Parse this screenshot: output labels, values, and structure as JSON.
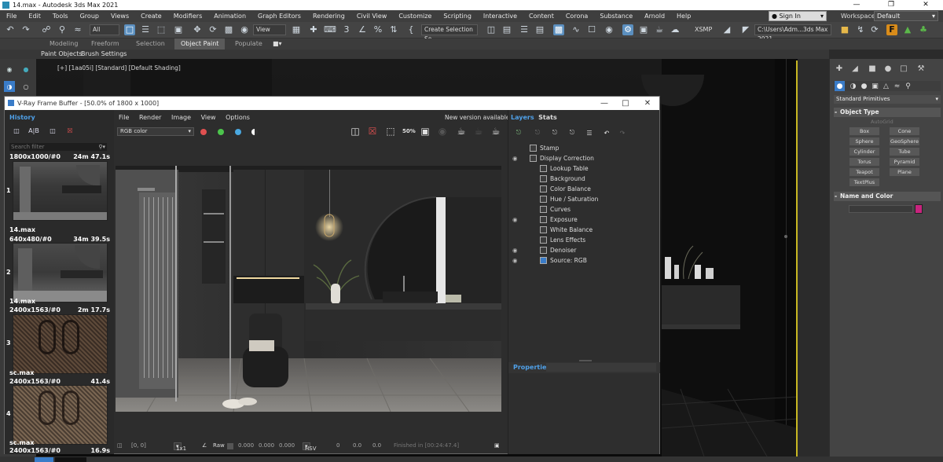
{
  "window": {
    "title": "14.max - Autodesk 3ds Max 2021"
  },
  "menu": [
    "File",
    "Edit",
    "Tools",
    "Group",
    "Views",
    "Create",
    "Modifiers",
    "Animation",
    "Graph Editors",
    "Rendering",
    "Civil View",
    "Customize",
    "Scripting",
    "Interactive",
    "Content",
    "Corona",
    "Substance",
    "Arnold",
    "Help"
  ],
  "account": {
    "signin": "Sign In",
    "workspaces_label": "Workspaces:",
    "workspace": "Default"
  },
  "toolbar": {
    "filter": "All",
    "view": "View",
    "selection_set": "Create Selection Se",
    "xsmp": "XSMP",
    "path": "C:\\Users\\Adm...3ds Max 2021"
  },
  "ribbon": {
    "tabs": [
      "Modeling",
      "Freeform",
      "Selection",
      "Object Paint",
      "Populate"
    ],
    "active": "Object Paint",
    "sub": [
      "Paint Objects",
      "Brush Settings"
    ]
  },
  "viewport": {
    "label": "[+] [1aa05i] [Standard] [Default Shading]"
  },
  "command_panel": {
    "dropdown": "Standard Primitives",
    "object_type": "Object Type",
    "autogrid": "AutoGrid",
    "buttons": [
      "Box",
      "Cone",
      "Sphere",
      "GeoSphere",
      "Cylinder",
      "Tube",
      "Torus",
      "Pyramid",
      "Teapot",
      "Plane",
      "TextPlus"
    ],
    "name_color": "Name and Color",
    "color_swatch": "#c8247e"
  },
  "vfb": {
    "title": "V-Ray Frame Buffer - [50.0% of 1800 x 1000]",
    "menu": [
      "File",
      "Render",
      "Image",
      "View",
      "Options"
    ],
    "new_version": "New version available!",
    "channel": "RGB color",
    "history": {
      "heading": "History",
      "search": "Search filter",
      "items": [
        {
          "res": "1800x1000/#0",
          "time": "24m 47.1s",
          "index": "1",
          "name": "14.max"
        },
        {
          "res": "640x480/#0",
          "time": "34m 39.5s",
          "index": "2",
          "name": "14.max"
        },
        {
          "res": "2400x1563/#0",
          "time": "2m 17.7s",
          "index": "3",
          "name": "sc.max"
        },
        {
          "res": "2400x1563/#0",
          "time": "41.4s",
          "index": "4",
          "name": "sc.max"
        },
        {
          "res": "2400x1563/#0",
          "time": "16.9s",
          "index": "",
          "name": ""
        }
      ]
    },
    "layers": {
      "tab_layers": "Layers",
      "tab_stats": "Stats",
      "items": [
        "Stamp",
        "Display Correction",
        "Lookup Table",
        "Background",
        "Color Balance",
        "Hue / Saturation",
        "Curves",
        "Exposure",
        "White Balance",
        "Lens Effects",
        "Denoiser",
        "Source: RGB"
      ]
    },
    "properties": "Properties",
    "status": {
      "coords": "[0, 0]",
      "zoom": "1x1",
      "raw": "Raw",
      "r": "0.000",
      "g": "0.000",
      "b": "0.000",
      "mode": "HSV",
      "h": "0",
      "s": "0.0",
      "v": "0.0",
      "finished": "Finished in [00:24:47.4]"
    }
  }
}
